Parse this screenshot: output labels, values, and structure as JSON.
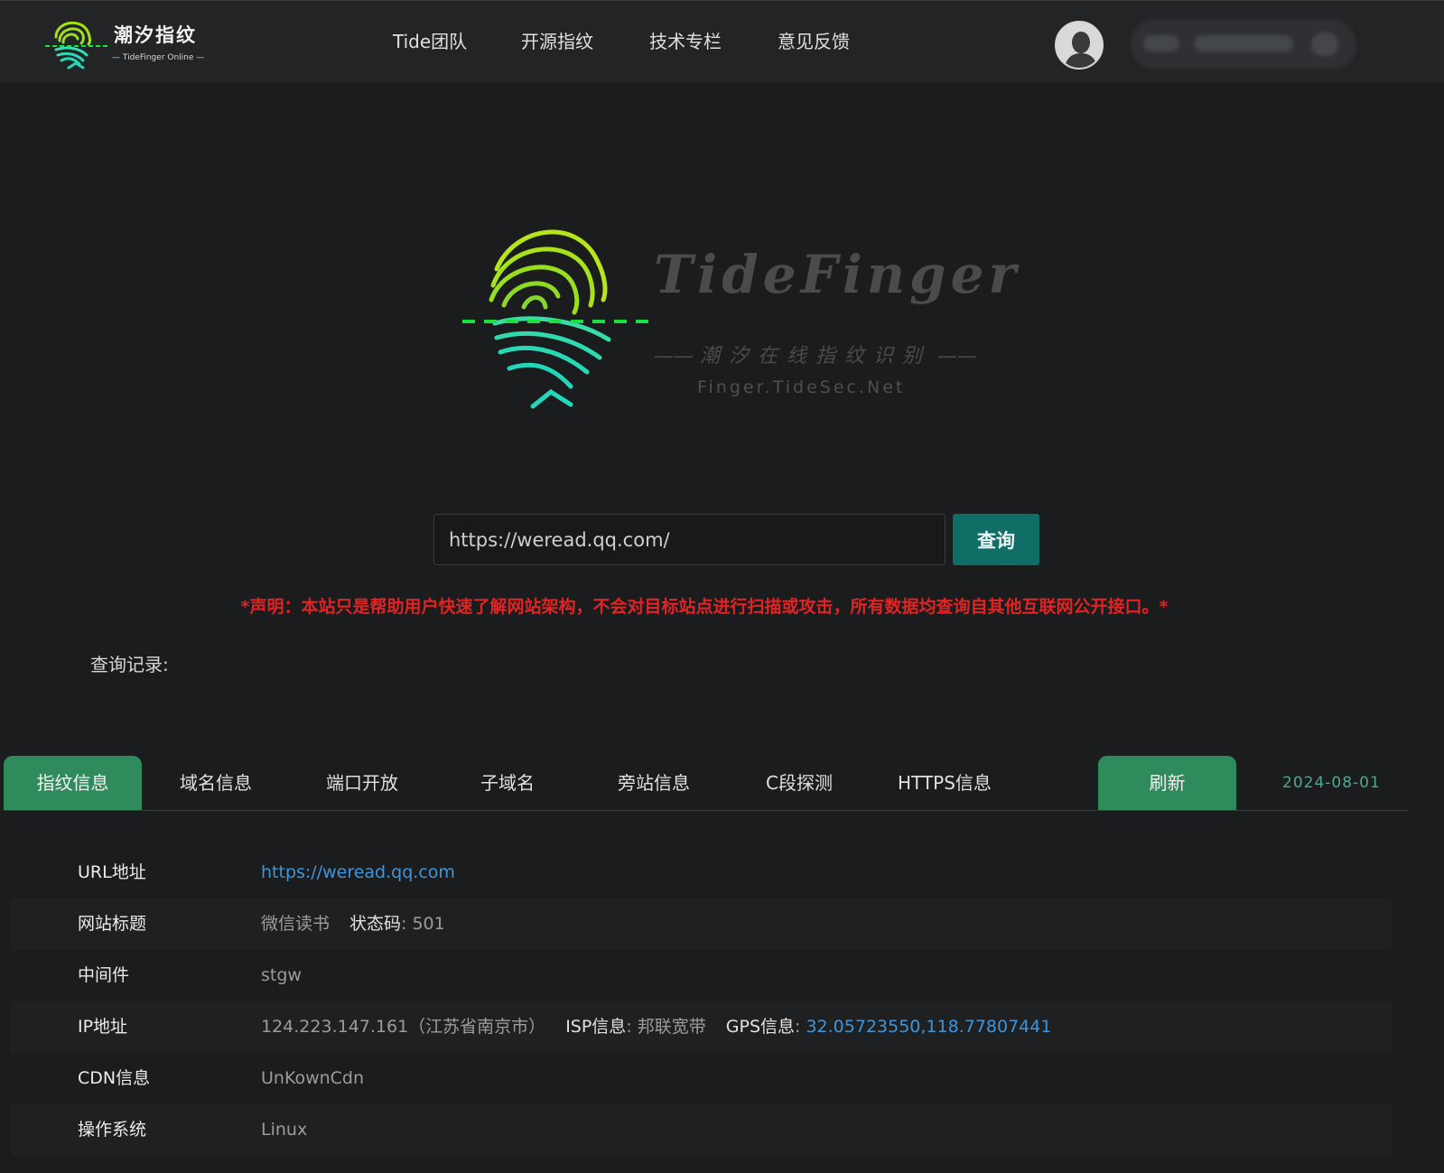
{
  "brand": {
    "name": "潮汐指纹",
    "subtitle": "— TideFinger Online —"
  },
  "nav": {
    "items": [
      {
        "label": "Tide团队"
      },
      {
        "label": "开源指纹"
      },
      {
        "label": "技术专栏"
      },
      {
        "label": "意见反馈"
      }
    ]
  },
  "user": {
    "avatar_icon": "user-silhouette-icon"
  },
  "hero": {
    "title": "TideFinger",
    "subtitle_cn": "潮汐在线指纹识别",
    "url": "Finger.TideSec.Net",
    "colors": {
      "green": "#a4e01a",
      "teal": "#20d8b8",
      "dash": "#1ee03c"
    }
  },
  "search": {
    "value": "https://weread.qq.com/",
    "button_label": "查询"
  },
  "notice": "*声明：本站只是帮助用户快速了解网站架构，不会对目标站点进行扫描或攻击，所有数据均查询自其他互联网公开接口。*",
  "history_label": "查询记录:",
  "tabs": {
    "items": [
      {
        "label": "指纹信息"
      },
      {
        "label": "域名信息"
      },
      {
        "label": "端口开放"
      },
      {
        "label": "子域名"
      },
      {
        "label": "旁站信息"
      },
      {
        "label": "C段探测"
      },
      {
        "label": "HTTPS信息"
      }
    ],
    "active": "指纹信息",
    "refresh_label": "刷新",
    "date": "2024-08-01"
  },
  "info": {
    "url": {
      "label": "URL地址",
      "value": "https://weread.qq.com"
    },
    "title": {
      "label": "网站标题",
      "value": "微信读书",
      "status_key": "状态码",
      "status_value": ": 501"
    },
    "middleware": {
      "label": "中间件",
      "value": "stgw"
    },
    "ip": {
      "label": "IP地址",
      "value": "124.223.147.161（江苏省南京市）",
      "isp_key": "ISP信息",
      "isp_value": ": 邦联宽带",
      "gps_key": "GPS信息",
      "gps_sep": ": ",
      "gps_value": "32.05723550,118.77807441"
    },
    "cdn": {
      "label": "CDN信息",
      "value": "UnKownCdn"
    },
    "os": {
      "label": "操作系统",
      "value": "Linux"
    }
  },
  "colors": {
    "background": "#1b1c1e",
    "topbar": "#222426",
    "accent_green": "#2f8b5c",
    "search_button": "#0f6e66",
    "notice_red": "#e02424",
    "link_blue": "#3f95d8"
  }
}
